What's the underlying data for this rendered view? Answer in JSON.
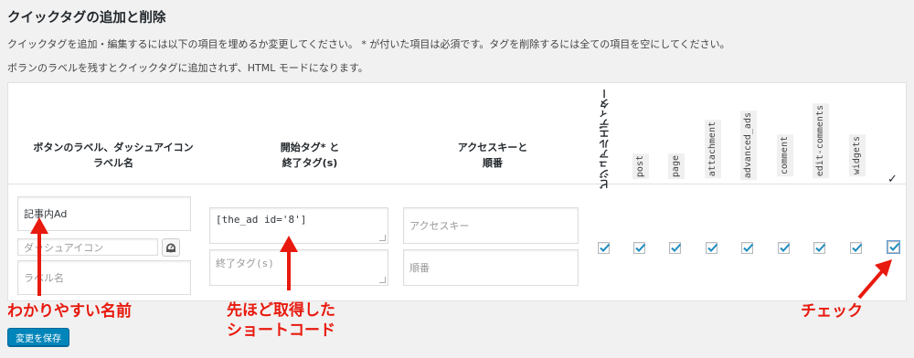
{
  "page": {
    "title": "クイックタグの追加と削除",
    "desc1": "クイックタグを追加・編集するには以下の項目を埋めるか変更してください。 * が付いた項目は必須です。タグを削除するには全ての項目を空にしてください。",
    "desc2": "ボランのラベルを残すとクイックタグに追加されず、HTML モードになります。"
  },
  "table": {
    "headers": {
      "label_col_1": "ボタンのラベル、ダッシュアイコン",
      "label_col_2": "ラベル名",
      "tags_col_1": "開始タグ* と",
      "tags_col_2": "終了タグ(s)",
      "access_col_1": "アクセスキーと",
      "access_col_2": "順番",
      "visual_editor": "ビジュアルエディター",
      "post_types": [
        "post",
        "page",
        "attachment",
        "advanced_ads",
        "comment",
        "edit-comments",
        "widgets"
      ],
      "check_all": "✓"
    },
    "row": {
      "button_label": "記事内Ad",
      "dashicon_placeholder": "ダッシュアイコン",
      "label_name_placeholder": "ラベル名",
      "start_tag": "[the_ad id='8']",
      "end_tag_placeholder": "終了タグ(s)",
      "access_key_placeholder": "アクセスキー",
      "order_placeholder": "順番",
      "checkboxes": [
        true,
        true,
        true,
        true,
        true,
        true,
        true,
        true,
        true
      ]
    }
  },
  "save_button": "変更を保存",
  "annotations": {
    "name_note": "わかりやすい名前",
    "shortcode_note_1": "先ほど取得した",
    "shortcode_note_2": "ショートコード",
    "check_note": "チェック"
  },
  "colors": {
    "accent": "#0085ba",
    "annotation": "#e8190e",
    "checkmark": "#1e8cbe"
  }
}
